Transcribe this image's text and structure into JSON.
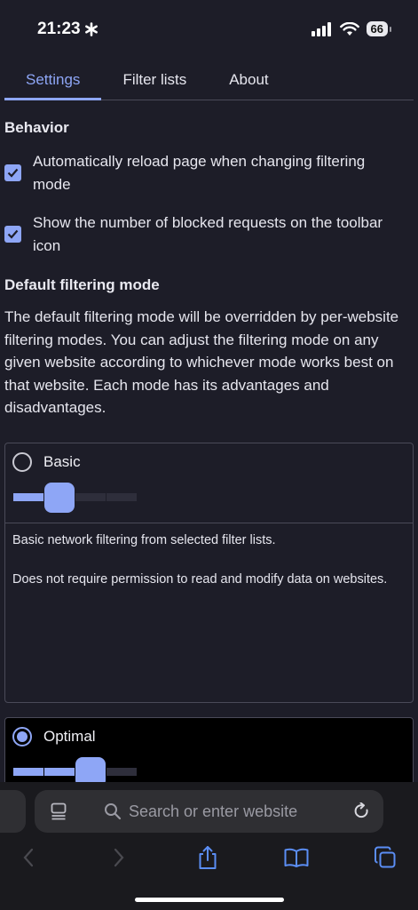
{
  "status_bar": {
    "time": "21:23",
    "battery": "66"
  },
  "tabs": [
    {
      "label": "Settings",
      "active": true
    },
    {
      "label": "Filter lists",
      "active": false
    },
    {
      "label": "About",
      "active": false
    }
  ],
  "behavior": {
    "title": "Behavior",
    "options": [
      {
        "label": "Automatically reload page when changing filtering mode",
        "checked": true
      },
      {
        "label": "Show the number of blocked requests on the toolbar icon",
        "checked": true
      }
    ]
  },
  "filtering": {
    "title": "Default filtering mode",
    "description": "The default filtering mode will be overridden by per-website filtering modes. You can adjust the filtering mode on any given website according to whichever mode works best on that website. Each mode has its advantages and disadvantages.",
    "modes": [
      {
        "label": "Basic",
        "selected": false,
        "level": 2,
        "levels": 4,
        "desc1": "Basic network filtering from selected filter lists.",
        "desc2": "Does not require permission to read and modify data on websites."
      },
      {
        "label": "Optimal",
        "selected": true,
        "level": 3,
        "levels": 4
      }
    ]
  },
  "browser": {
    "search_placeholder": "Search or enter website"
  },
  "colors": {
    "accent": "#8ea6f6",
    "background": "#1d1d28"
  }
}
